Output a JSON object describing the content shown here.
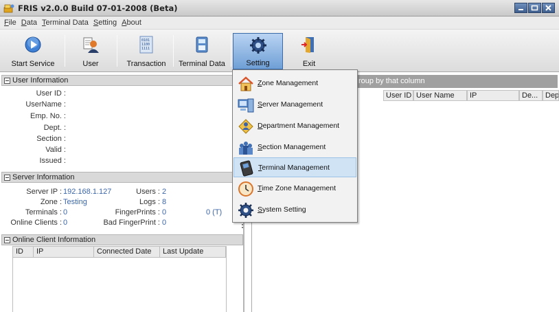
{
  "window": {
    "title": "FRIS v2.0.0 Build 07-01-2008 (Beta)"
  },
  "menu": [
    {
      "label": "File",
      "key": "F"
    },
    {
      "label": "Data",
      "key": "D"
    },
    {
      "label": "Terminal Data",
      "key": "T"
    },
    {
      "label": "Setting",
      "key": "S"
    },
    {
      "label": "About",
      "key": "A"
    }
  ],
  "toolbar": {
    "start_service": "Start Service",
    "user": "User",
    "transaction": "Transaction",
    "terminal_data": "Terminal Data",
    "setting": "Setting",
    "exit": "Exit"
  },
  "user_info": {
    "title": "User Information",
    "labels": [
      "User ID :",
      "UserName :",
      "Emp. No. :",
      "Dept. :",
      "Section :",
      "Valid :",
      "Issued :"
    ]
  },
  "server_info": {
    "title": "Server Information",
    "server_ip_label": "Server IP :",
    "server_ip": "192.168.1.127",
    "zone_label": "Zone :",
    "zone": "Testing",
    "terminals_label": "Terminals :",
    "terminals": "0",
    "online_clients_label": "Online Clients :",
    "online_clients": "0",
    "users_label": "Users :",
    "users": "2",
    "logs_label": "Logs :",
    "logs": "8",
    "fingerprints_label": "FingerPrints :",
    "fingerprints": "0",
    "fingerprints_t": "0 (T)",
    "bad_fingerprint_label": "Bad FingerPrint :",
    "bad_fingerprint": "0"
  },
  "online_clients": {
    "title": "Online Client Information",
    "columns": [
      "ID",
      "IP",
      "Connected Date",
      "Last Update"
    ]
  },
  "grid": {
    "group_hint": "roup by that column",
    "columns": [
      "User ID",
      "User Name",
      "IP",
      "De...",
      "Dep"
    ]
  },
  "setting_menu": [
    {
      "label": "Zone Management",
      "icon": "home-icon"
    },
    {
      "label": "Server Management",
      "icon": "server-icon"
    },
    {
      "label": "Department Management",
      "icon": "department-icon"
    },
    {
      "label": "Section Management",
      "icon": "group-icon"
    },
    {
      "label": "Terminal Management",
      "icon": "terminal-icon"
    },
    {
      "label": "Time Zone Management",
      "icon": "clock-icon"
    },
    {
      "label": "System Setting",
      "icon": "gear-icon"
    }
  ],
  "highlighted_menu_item": "Terminal Management"
}
